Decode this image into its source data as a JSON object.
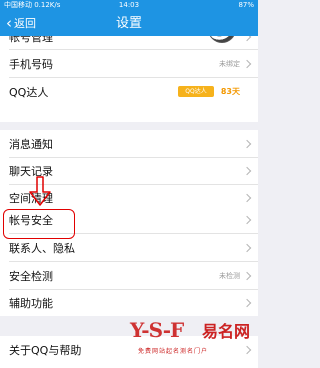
{
  "status_bar": {
    "left": "中国移动 0.12K/s",
    "time": "14:03",
    "right": "87%"
  },
  "nav": {
    "back_label": "返回",
    "title": "设置"
  },
  "rows": {
    "account_manage": {
      "label": "帐号管理"
    },
    "phone_number": {
      "label": "手机号码",
      "value": "未绑定"
    },
    "qq_master": {
      "label": "QQ达人",
      "badge": "QQ达人",
      "days": "83天"
    },
    "notifications": {
      "label": "消息通知"
    },
    "chat_history": {
      "label": "聊天记录"
    },
    "storage_cleanup": {
      "label": "空间清理"
    },
    "account_security": {
      "label": "帐号安全"
    },
    "contacts_privacy": {
      "label": "联系人、隐私"
    },
    "security_check": {
      "label": "安全检测",
      "value": "未检测"
    },
    "accessibility": {
      "label": "辅助功能"
    },
    "about": {
      "label": "关于QQ与帮助"
    }
  },
  "annotation": {
    "highlight_color": "#e10000"
  },
  "watermark": {
    "logo": "Y-S-F",
    "name": "易名网",
    "tagline": "免费网站起名测名门户"
  },
  "colors": {
    "header": "#1e94e3",
    "background": "#efeff4",
    "badge": "#f6b21c",
    "days": "#f39800"
  }
}
